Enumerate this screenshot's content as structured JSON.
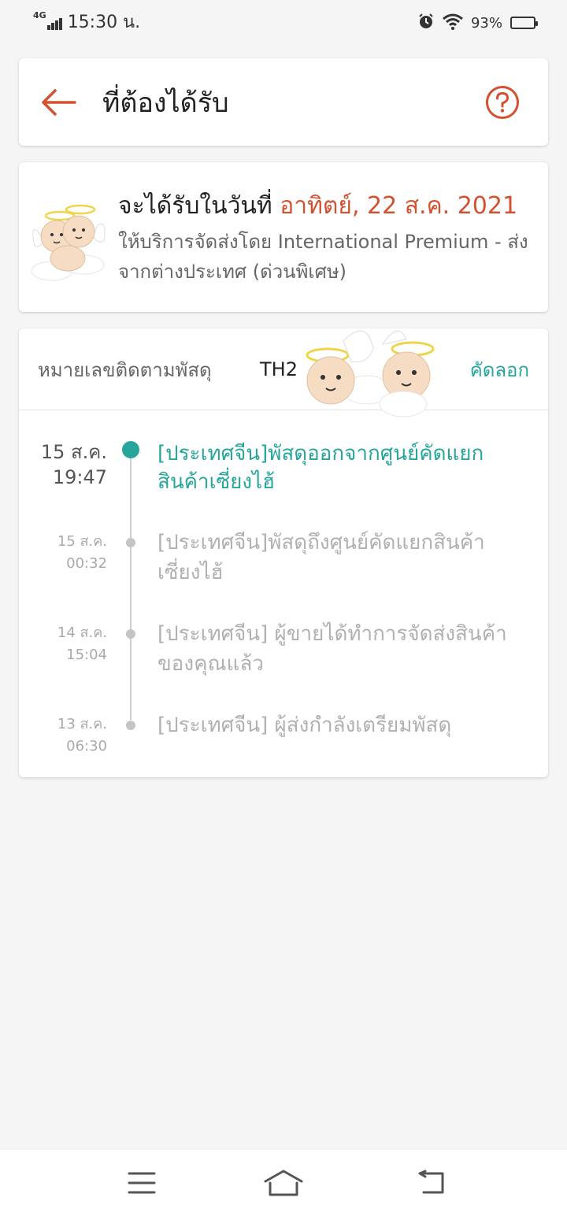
{
  "status_bar": {
    "network": "4G",
    "time": "15:30 น.",
    "battery_percent": "93%",
    "battery_level": 0.93,
    "icons": [
      "alarm-icon",
      "wifi-icon",
      "battery-icon"
    ]
  },
  "header": {
    "title": "ที่ต้องได้รับ",
    "back_icon": "arrow-left-icon",
    "help_icon": "question-circle-icon"
  },
  "delivery_estimate": {
    "prefix": "จะได้รับในวันที่ ",
    "date": "อาทิตย์, 22 ส.ค. 2021",
    "service": "ให้บริการจัดส่งโดย International Premium - ส่งจากต่างประเทศ (ด่วนพิเศษ)",
    "illustration": "angel-babies-sticker"
  },
  "tracking": {
    "label": "หมายเลขติดตามพัสดุ",
    "number": "TH2",
    "copy_label": "คัดลอก",
    "sticker": "angel-babies-sticker"
  },
  "timeline": [
    {
      "date": "15 ส.ค.",
      "time": "19:47",
      "text": "[ประเทศจีน]พัสดุออกจากศูนย์คัดแยกสินค้าเซี่ยงไฮ้",
      "active": true
    },
    {
      "date": "15 ส.ค.",
      "time": "00:32",
      "text": "[ประเทศจีน]พัสดุถึงศูนย์คัดแยกสินค้าเซี่ยงไฮ้",
      "active": false
    },
    {
      "date": "14 ส.ค.",
      "time": "15:04",
      "text": "[ประเทศจีน] ผู้ขายได้ทำการจัดส่งสินค้าของคุณแล้ว",
      "active": false
    },
    {
      "date": "13 ส.ค.",
      "time": "06:30",
      "text": "[ประเทศจีน] ผู้ส่งกำลังเตรียมพัสดุ",
      "active": false
    }
  ],
  "nav_bar": {
    "icons": [
      "menu-icon",
      "home-icon",
      "back-icon"
    ]
  },
  "colors": {
    "accent": "#d4512f",
    "teal": "#26a69a",
    "background": "#f5f5f5"
  }
}
